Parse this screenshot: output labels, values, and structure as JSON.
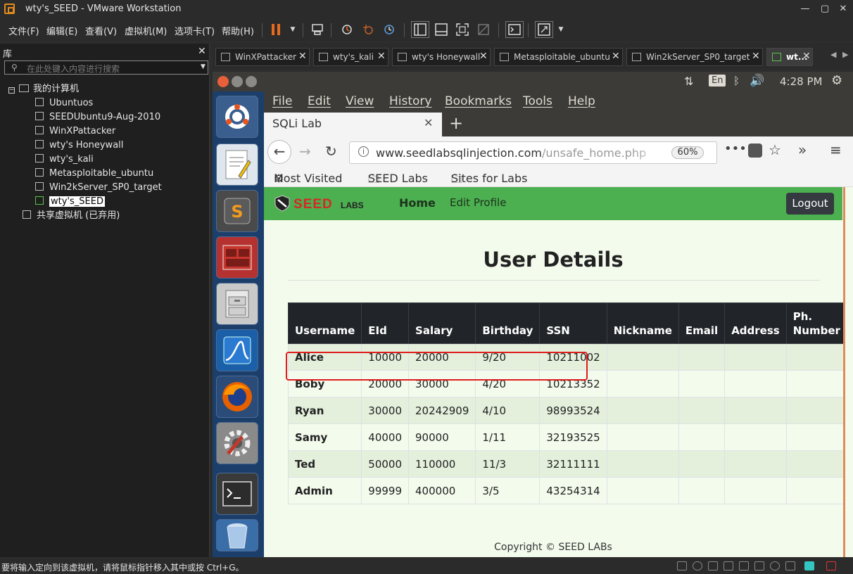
{
  "window": {
    "title": "wty's_SEED - VMware Workstation",
    "controls": [
      "—",
      "▢",
      "✕"
    ]
  },
  "menubar": {
    "items": [
      "文件(F)",
      "编辑(E)",
      "查看(V)",
      "虚拟机(M)",
      "选项卡(T)",
      "帮助(H)"
    ]
  },
  "library": {
    "header": "库",
    "close": "✕",
    "search_placeholder": "在此处键入内容进行搜索",
    "root": "我的计算机",
    "vms": [
      "Ubuntuos",
      "SEEDUbuntu9-Aug-2010",
      "WinXPattacker",
      "wty's Honeywall",
      "wty's_kali",
      "Metasploitable_ubuntu",
      "Win2kServer_SP0_target",
      "wty's_SEED"
    ],
    "selected": "wty's_SEED",
    "shared": "共享虚拟机 (已弃用)"
  },
  "vm_tabs": [
    {
      "label": "WinXPattacker"
    },
    {
      "label": "wty's_kali"
    },
    {
      "label": "wty's Honeywall"
    },
    {
      "label": "Metasploitable_ubuntu"
    },
    {
      "label": "Win2kServer_SP0_target"
    },
    {
      "label": "wt..."
    }
  ],
  "guest_topbar": {
    "lang": "En",
    "time": "4:28 PM"
  },
  "firefox": {
    "menu": [
      "File",
      "Edit",
      "View",
      "History",
      "Bookmarks",
      "Tools",
      "Help"
    ],
    "tab_title": "SQLi Lab",
    "url_host": "www.seedlabsqlinjection.com",
    "url_path": "/unsafe_home.php",
    "zoom": "60%",
    "bookmarks": [
      "Most Visited",
      "SEED Labs",
      "Sites for Labs"
    ]
  },
  "site": {
    "logo": "SEED LABS",
    "nav_home": "Home",
    "nav_edit": "Edit Profile",
    "logout": "Logout",
    "page_title": "User Details",
    "copyright": "Copyright © SEED LABs"
  },
  "table": {
    "headers": [
      "Username",
      "EId",
      "Salary",
      "Birthday",
      "SSN",
      "Nickname",
      "Email",
      "Address",
      "Ph. Number"
    ],
    "rows": [
      [
        "Alice",
        "10000",
        "20000",
        "9/20",
        "10211002",
        "",
        "",
        "",
        ""
      ],
      [
        "Boby",
        "20000",
        "30000",
        "4/20",
        "10213352",
        "",
        "",
        "",
        ""
      ],
      [
        "Ryan",
        "30000",
        "20242909",
        "4/10",
        "98993524",
        "",
        "",
        "",
        ""
      ],
      [
        "Samy",
        "40000",
        "90000",
        "1/11",
        "32193525",
        "",
        "",
        "",
        ""
      ],
      [
        "Ted",
        "50000",
        "110000",
        "11/3",
        "32111111",
        "",
        "",
        "",
        ""
      ],
      [
        "Admin",
        "99999",
        "400000",
        "3/5",
        "43254314",
        "",
        "",
        "",
        ""
      ]
    ]
  },
  "status": {
    "message": "要将输入定向到该虚拟机，请将鼠标指针移入其中或按 Ctrl+G。"
  },
  "colors": {
    "site_nav": "#4caf50",
    "table_header": "#212529",
    "highlight": "#e01d1d",
    "launcher": "#1c3e6b"
  }
}
